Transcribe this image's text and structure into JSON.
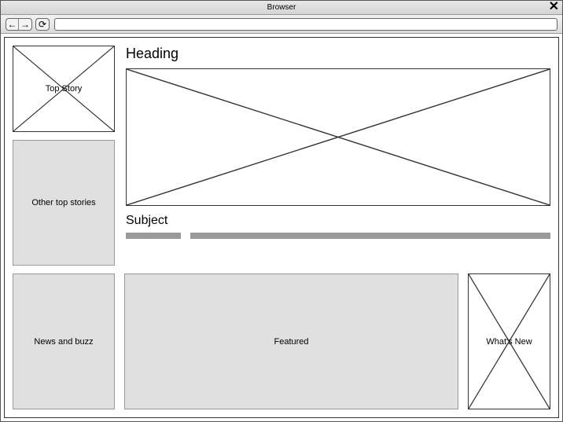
{
  "window": {
    "title": "Browser",
    "close_glyph": "✕"
  },
  "toolbar": {
    "back_glyph": "←",
    "forward_glyph": "→",
    "refresh_glyph": "⟳",
    "url": ""
  },
  "left": {
    "top_story": "Top Story",
    "other_top": "Other top stories"
  },
  "main": {
    "heading": "Heading",
    "subject": "Subject"
  },
  "bottom": {
    "news_buzz": "News and buzz",
    "featured": "Featured",
    "whats_new": "What's New"
  }
}
